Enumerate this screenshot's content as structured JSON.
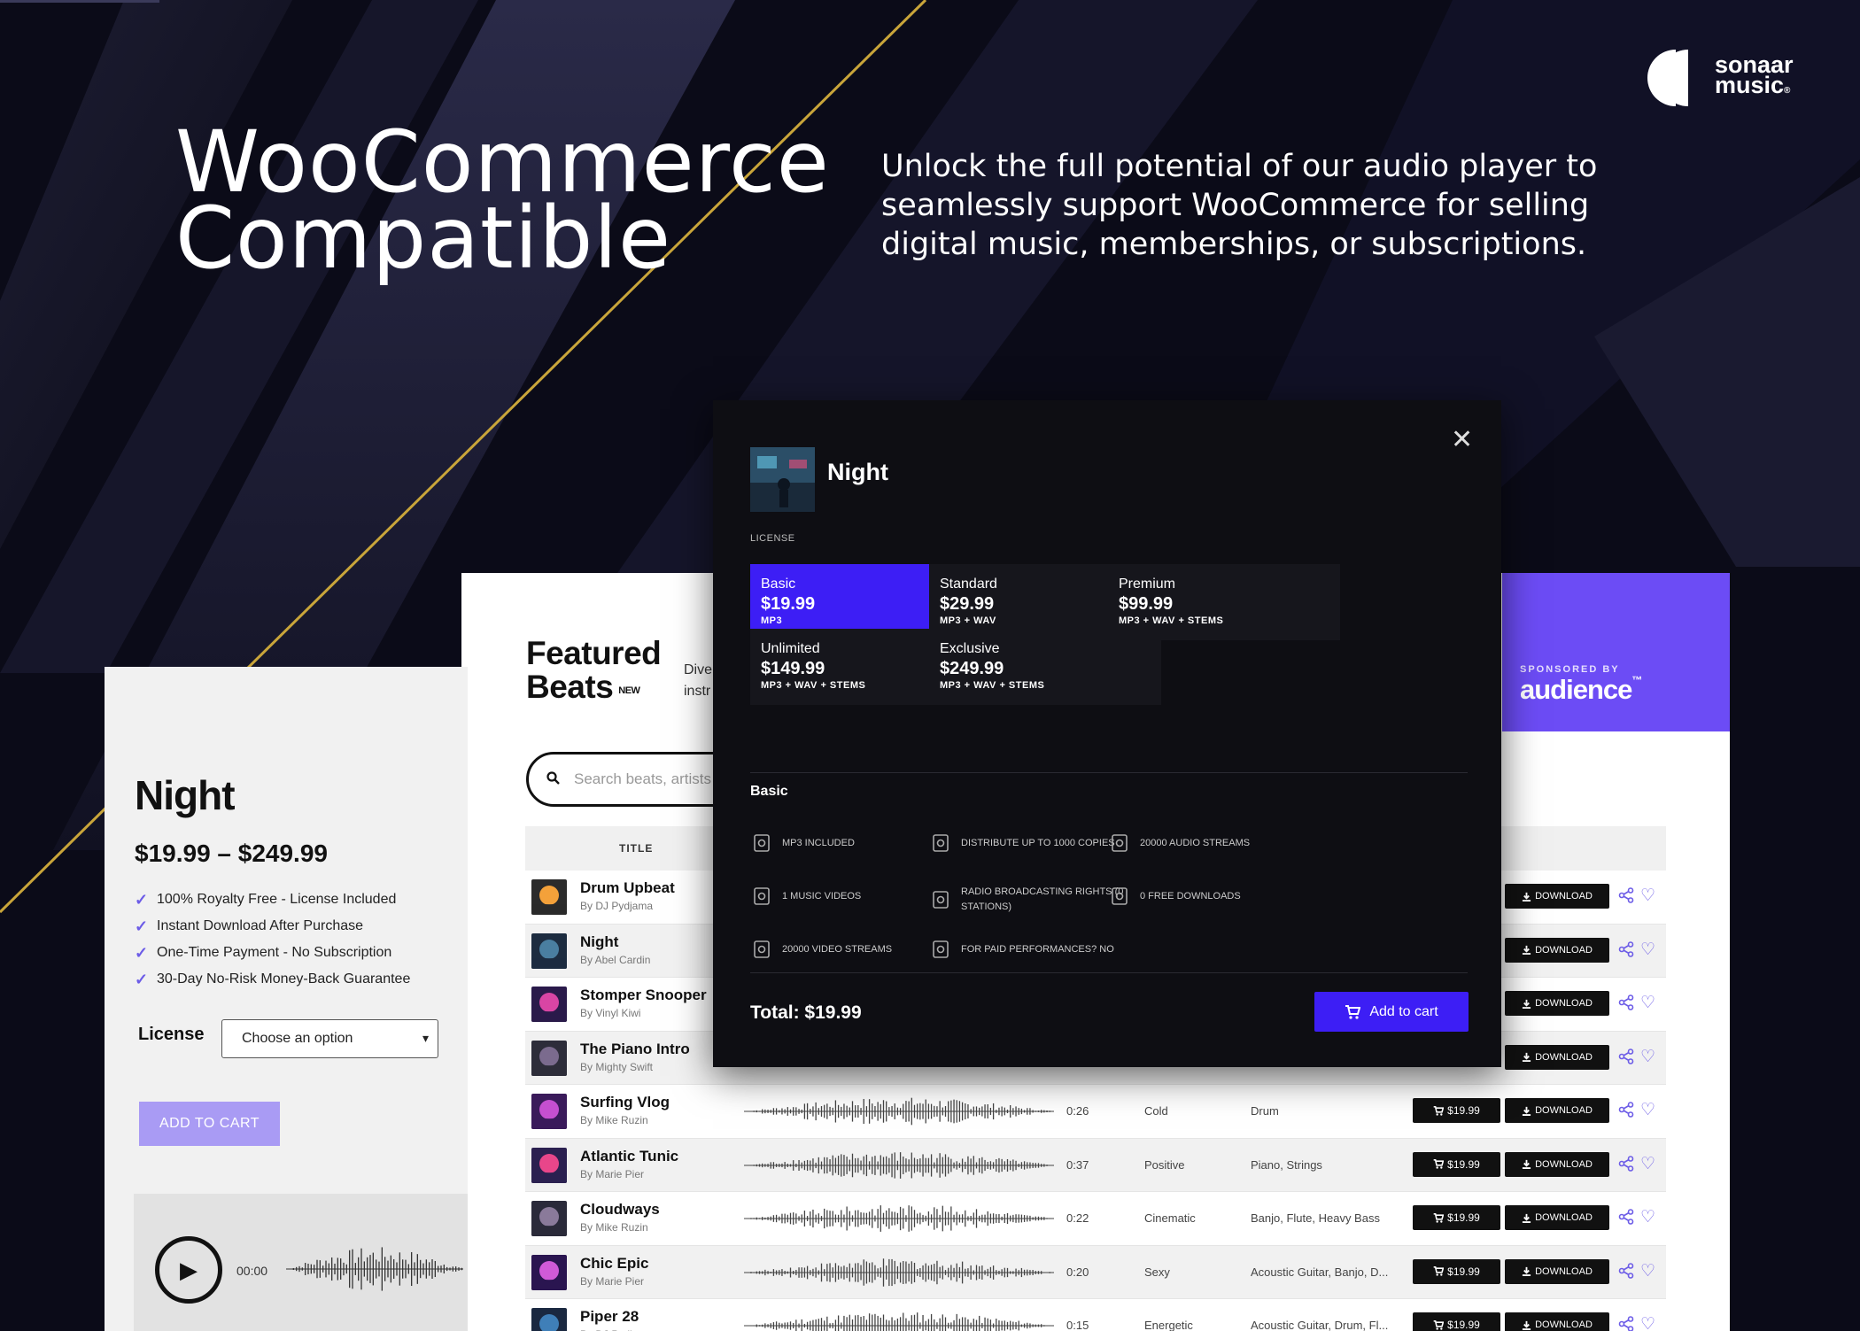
{
  "brand": {
    "name_line1": "sonaar",
    "name_line2": "music",
    "reg_mark": "®"
  },
  "hero": {
    "title_line1": "WooCommerce",
    "title_line2": "Compatible",
    "subtitle": "Unlock the full potential of our audio player to seamlessly support WooCommerce for selling digital music, memberships, or subscriptions."
  },
  "product": {
    "title": "Night",
    "price_range": "$19.99 – $249.99",
    "features": [
      "100% Royalty Free - License Included",
      "Instant Download After Purchase",
      "One-Time Payment - No Subscription",
      "30-Day No-Risk Money-Back Guarantee"
    ],
    "license_label": "License",
    "license_select": "Choose an option",
    "add_to_cart": "ADD TO CART",
    "player_time": "00:00"
  },
  "featured": {
    "title_line1": "Featured",
    "title_line2": "Beats",
    "badge": "NEW",
    "desc_line1": "Dive",
    "desc_line2": "instr",
    "search_placeholder": "Search beats, artists",
    "sponsor_label": "SPONSORED BY",
    "sponsor_name": "audience",
    "sponsor_tm": "™",
    "col_title": "TITLE",
    "download_label": "DOWNLOAD",
    "tracks": [
      {
        "name": "Drum Upbeat",
        "by": "By DJ Pydjama",
        "duration": "",
        "mood": "",
        "instruments": "",
        "price": ""
      },
      {
        "name": "Night",
        "by": "By Abel Cardin",
        "duration": "",
        "mood": "",
        "instruments": "",
        "price": ""
      },
      {
        "name": "Stomper Snooper",
        "by": "By Vinyl Kiwi",
        "duration": "",
        "mood": "",
        "instruments": "",
        "price": ""
      },
      {
        "name": "The Piano Intro",
        "by": "By Mighty Swift",
        "duration": "",
        "mood": "",
        "instruments": "",
        "price": ""
      },
      {
        "name": "Surfing Vlog",
        "by": "By Mike Ruzin",
        "duration": "0:26",
        "mood": "Cold",
        "instruments": "Drum",
        "price": "$19.99"
      },
      {
        "name": "Atlantic Tunic",
        "by": "By Marie Pier",
        "duration": "0:37",
        "mood": "Positive",
        "instruments": "Piano, Strings",
        "price": "$19.99"
      },
      {
        "name": "Cloudways",
        "by": "By Mike Ruzin",
        "duration": "0:22",
        "mood": "Cinematic",
        "instruments": "Banjo, Flute, Heavy Bass",
        "price": "$19.99"
      },
      {
        "name": "Chic Epic",
        "by": "By Marie Pier",
        "duration": "0:20",
        "mood": "Sexy",
        "instruments": "Acoustic Guitar, Banjo, D...",
        "price": "$19.99"
      },
      {
        "name": "Piper 28",
        "by": "By DJ Pydjama",
        "duration": "0:15",
        "mood": "Energetic",
        "instruments": "Acoustic Guitar, Drum, Fl...",
        "price": "$19.99"
      }
    ]
  },
  "modal": {
    "title": "Night",
    "license_label": "LICENSE",
    "options": [
      {
        "name": "Basic",
        "price": "$19.99",
        "formats": "MP3"
      },
      {
        "name": "Standard",
        "price": "$29.99",
        "formats": "MP3 + WAV"
      },
      {
        "name": "Premium",
        "price": "$99.99",
        "formats": "MP3 + WAV + STEMS"
      },
      {
        "name": "Unlimited",
        "price": "$149.99",
        "formats": "MP3 + WAV + STEMS"
      },
      {
        "name": "Exclusive",
        "price": "$249.99",
        "formats": "MP3 + WAV + STEMS"
      }
    ],
    "selected_name": "Basic",
    "features": [
      "MP3 INCLUDED",
      "DISTRIBUTE UP TO 1000 COPIES",
      "20000 AUDIO STREAMS",
      "1 MUSIC VIDEOS",
      "RADIO BROADCASTING RIGHTS (0 STATIONS)",
      "0 FREE DOWNLOADS",
      "20000 VIDEO STREAMS",
      "FOR PAID PERFORMANCES? NO"
    ],
    "total": "Total: $19.99",
    "add_to_cart": "Add to cart"
  },
  "colors": {
    "accent": "#3d1ef5",
    "sponsor_bg": "#6c4cf5",
    "page_bg": "#0b0b18",
    "check": "#6c5ce7"
  },
  "icons": [
    "close-icon",
    "search-icon",
    "check-icon",
    "cart-icon",
    "download-icon",
    "share-icon",
    "heart-icon",
    "play-icon"
  ]
}
